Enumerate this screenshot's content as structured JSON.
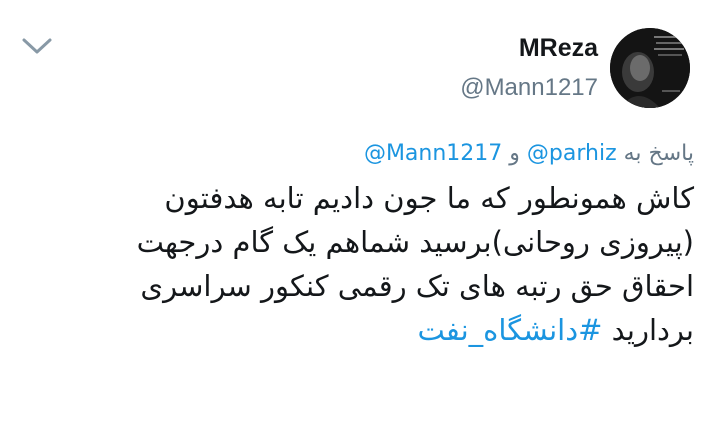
{
  "tweet": {
    "author": {
      "display_name": "MReza",
      "handle": "@Mann1217"
    },
    "reply_context": {
      "prefix": "پاسخ به",
      "mentions": [
        "@parhiz",
        "@Mann1217"
      ],
      "conjunction": "و"
    },
    "body_lines": [
      "کاش همونطور که ما جون دادیم تابه هدفتون",
      "(پیروزی روحانی)برسید شماهم یک گام درجهت",
      "احقاق حق رتبه های تک رقمی کنکور سراسری"
    ],
    "last_line_text": "بردارید",
    "hashtag": "#دانشگاه_نفت"
  },
  "icons": {
    "menu": "chevron-down-icon"
  },
  "colors": {
    "link": "#1b95e0",
    "secondary_text": "#657786",
    "primary_text": "#14171a"
  }
}
